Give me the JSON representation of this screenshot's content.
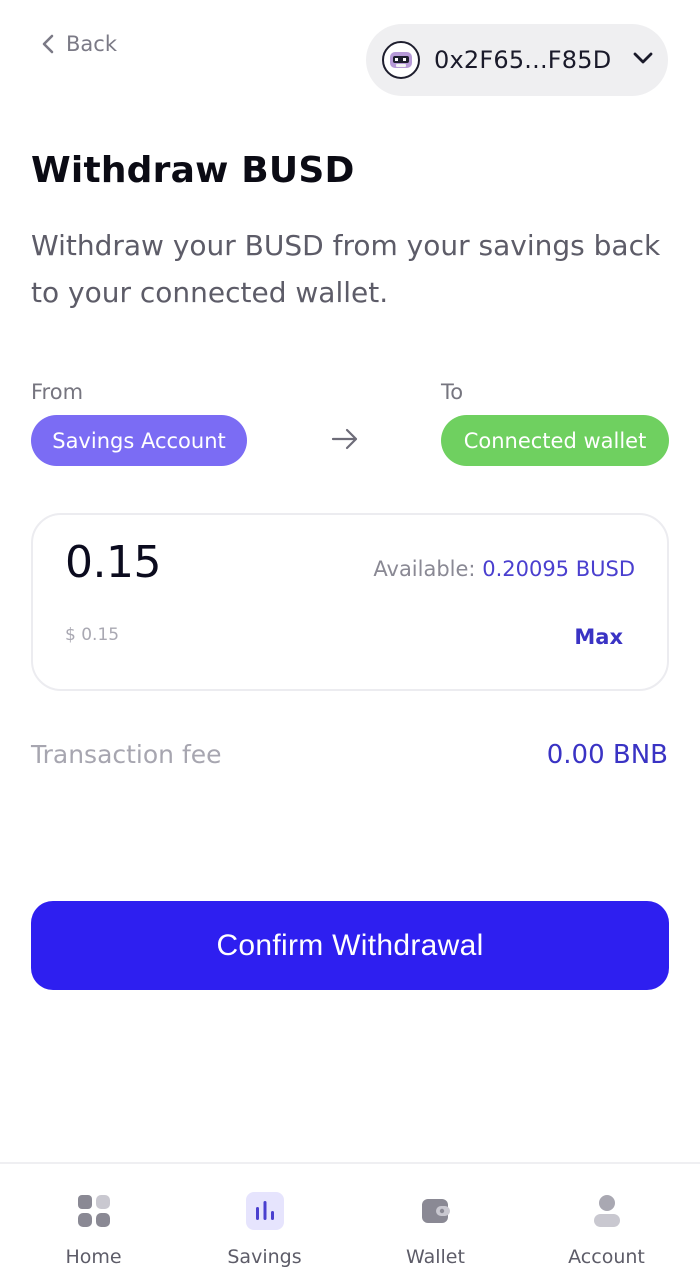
{
  "header": {
    "back_label": "Back",
    "wallet_address": "0x2F65...F85D"
  },
  "page": {
    "title": "Withdraw BUSD",
    "subtitle": "Withdraw your BUSD from your savings back to your connected wallet."
  },
  "transfer": {
    "from_label": "From",
    "from_value": "Savings Account",
    "to_label": "To",
    "to_value": "Connected wallet"
  },
  "amount_card": {
    "amount": "0.15",
    "available_label": "Available:",
    "available_value": "0.20095 BUSD",
    "usd_value": "$ 0.15",
    "max_label": "Max"
  },
  "fee": {
    "label": "Transaction fee",
    "value": "0.00 BNB"
  },
  "confirm_label": "Confirm Withdrawal",
  "nav": {
    "items": [
      {
        "label": "Home",
        "icon": "home-grid-icon",
        "active": false
      },
      {
        "label": "Savings",
        "icon": "savings-chart-icon",
        "active": true
      },
      {
        "label": "Wallet",
        "icon": "wallet-icon",
        "active": false
      },
      {
        "label": "Account",
        "icon": "account-user-icon",
        "active": false
      }
    ]
  },
  "colors": {
    "primary": "#2e1ff0",
    "from_chip": "#7b6cf4",
    "to_chip": "#6fd060",
    "accent_text": "#3a33c4"
  }
}
